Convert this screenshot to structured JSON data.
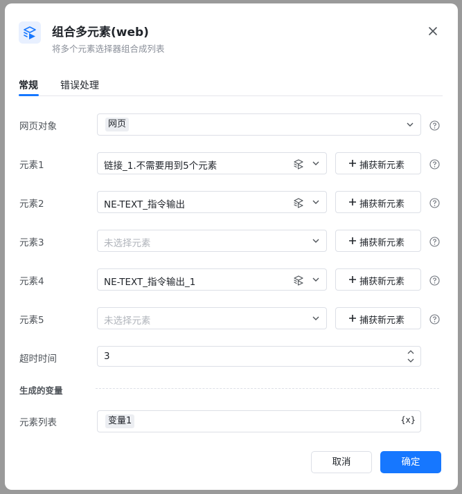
{
  "dialog": {
    "title": "组合多元素(web)",
    "subtitle": "将多个元素选择器组合成列表",
    "icon": "layers-play-icon",
    "close_icon": "close-icon"
  },
  "tabs": [
    {
      "label": "常规",
      "active": true
    },
    {
      "label": "错误处理",
      "active": false
    }
  ],
  "form": {
    "webpage": {
      "label": "网页对象",
      "value": "网页"
    },
    "elements": [
      {
        "label": "元素1",
        "value": "链接_1.不需要用到5个元素",
        "placeholder": "未选择元素",
        "selected": true
      },
      {
        "label": "元素2",
        "value": "NE-TEXT_指令输出",
        "placeholder": "未选择元素",
        "selected": true
      },
      {
        "label": "元素3",
        "value": "",
        "placeholder": "未选择元素",
        "selected": false
      },
      {
        "label": "元素4",
        "value": "NE-TEXT_指令输出_1",
        "placeholder": "未选择元素",
        "selected": true
      },
      {
        "label": "元素5",
        "value": "",
        "placeholder": "未选择元素",
        "selected": false
      }
    ],
    "capture_label": "捕获新元素",
    "timeout": {
      "label": "超时时间",
      "value": "3"
    }
  },
  "output": {
    "section_title": "生成的变量",
    "list": {
      "label": "元素列表",
      "value": "变量1",
      "var_icon": "{x}"
    }
  },
  "footer": {
    "cancel": "取消",
    "ok": "确定"
  },
  "colors": {
    "accent": "#1677ff",
    "border": "#dcdfe6",
    "label": "#4e5359",
    "placeholder": "#b0b4bb"
  }
}
